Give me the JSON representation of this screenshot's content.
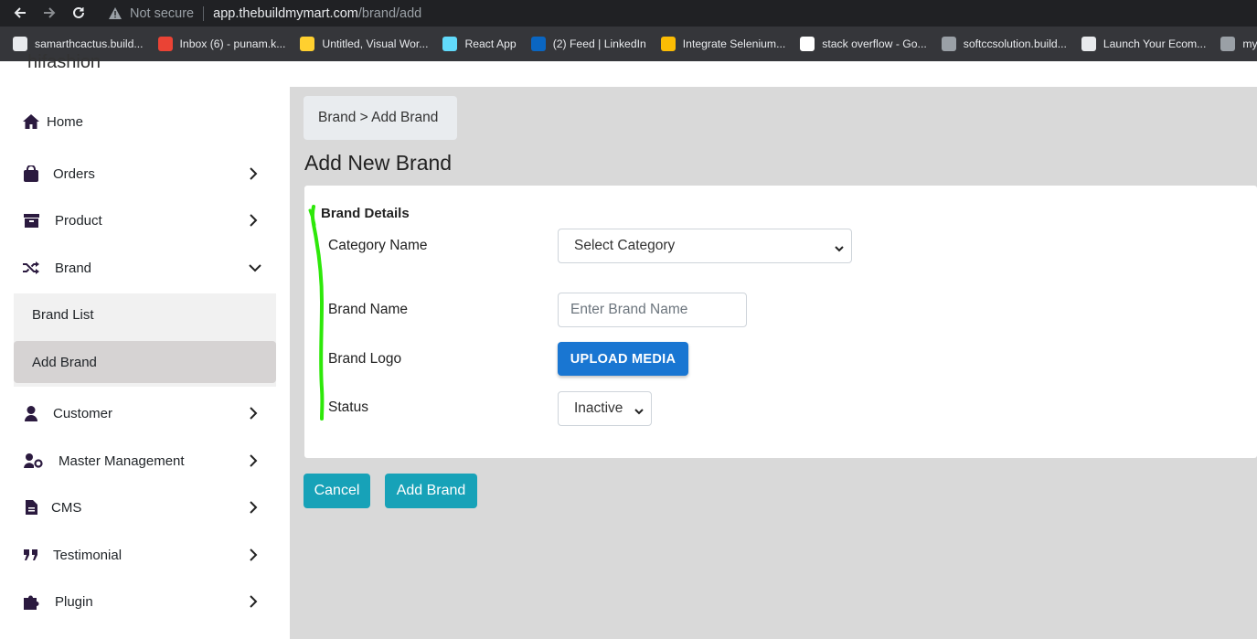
{
  "browser": {
    "not_secure": "Not secure",
    "url_host": "app.thebuildmymart.com",
    "url_path": "/brand/add",
    "bookmarks": [
      {
        "label": "samarthcactus.build...",
        "icon": "cactus-favicon",
        "color": "#e8eaed"
      },
      {
        "label": "Inbox (6) - punam.k...",
        "icon": "gmail-icon",
        "color": "#ea4335"
      },
      {
        "label": "Untitled, Visual Wor...",
        "icon": "miro-icon",
        "color": "#ffd02f"
      },
      {
        "label": "React App",
        "icon": "react-icon",
        "color": "#61dafb"
      },
      {
        "label": "(2) Feed | LinkedIn",
        "icon": "linkedin-icon",
        "color": "#0a66c2"
      },
      {
        "label": "Integrate Selenium...",
        "icon": "chrome-icon",
        "color": "#fbbc04"
      },
      {
        "label": "stack overflow - Go...",
        "icon": "google-icon",
        "color": "#ffffff"
      },
      {
        "label": "softccsolution.build...",
        "icon": "globe-icon",
        "color": "#9aa0a6"
      },
      {
        "label": "Launch Your Ecom...",
        "icon": "shop-icon",
        "color": "#e8eaed"
      },
      {
        "label": "myfashio",
        "icon": "globe-icon",
        "color": "#9aa0a6"
      }
    ]
  },
  "sidebar": {
    "brand_name": "hifashion",
    "items": [
      {
        "label": "Home",
        "icon": "home-icon"
      },
      {
        "label": "Orders",
        "icon": "shopping-bag-icon"
      },
      {
        "label": "Product",
        "icon": "archive-box-icon"
      },
      {
        "label": "Brand",
        "icon": "shuffle-icon"
      },
      {
        "label": "Customer",
        "icon": "user-icon"
      },
      {
        "label": "Master Management",
        "icon": "user-gear-icon"
      },
      {
        "label": "CMS",
        "icon": "document-icon"
      },
      {
        "label": "Testimonial",
        "icon": "quote-icon"
      },
      {
        "label": "Plugin",
        "icon": "puzzle-icon"
      }
    ],
    "brand_sub": [
      {
        "label": "Brand List"
      },
      {
        "label": "Add Brand",
        "active": true
      }
    ]
  },
  "main": {
    "breadcrumb": "Brand > Add Brand",
    "title": "Add New Brand",
    "section_title": "Brand Details",
    "fields": {
      "category_label": "Category Name",
      "category_value": "Select Category",
      "brand_name_label": "Brand Name",
      "brand_name_placeholder": "Enter Brand Name",
      "logo_label": "Brand Logo",
      "upload_label": "UPLOAD MEDIA",
      "status_label": "Status",
      "status_value": "Inactive"
    },
    "cancel_label": "Cancel",
    "submit_label": "Add Brand"
  },
  "colors": {
    "accent_blue": "#1976d2",
    "teal_button": "#17a2b8",
    "main_bg": "#d9d9d9",
    "annotation_green": "#2ee80a"
  }
}
